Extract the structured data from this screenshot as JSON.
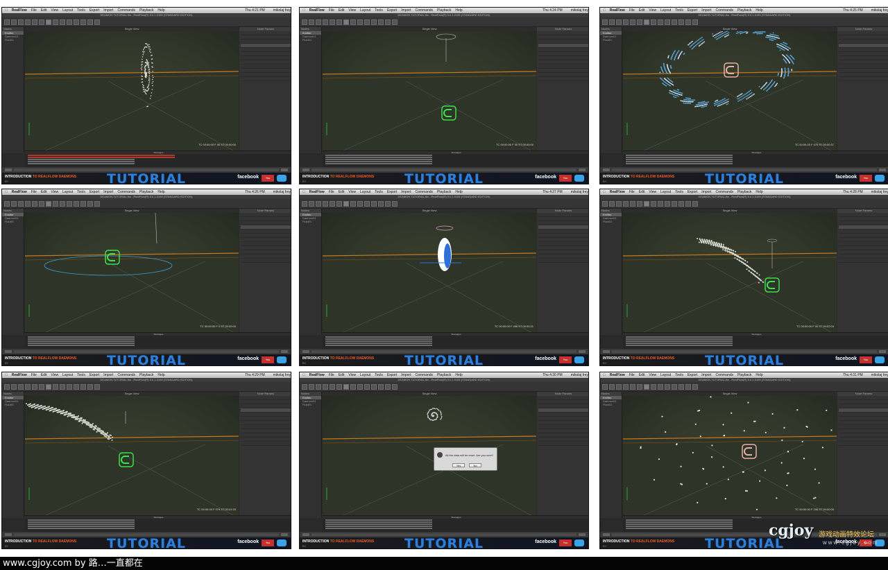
{
  "sheet": {
    "caption": "www.cgjoy.com by 路…一直都在"
  },
  "common": {
    "apple_menu": "",
    "app_name": "RealFlow",
    "menus": [
      "File",
      "Edit",
      "View",
      "Layout",
      "Tools",
      "Export",
      "Import",
      "Commands",
      "Playback",
      "Help"
    ],
    "user": "mikolaj frey",
    "nodes_header": "Nodes",
    "view_header": "Single View",
    "params_header": "Node Params",
    "messages_header": "Messages",
    "banner_intro_bold": "INTRODUCTION",
    "banner_intro_rest": " TO REALFLOW DAEMONS",
    "banner_by": "BY",
    "banner_tutorial": "TUTORIAL",
    "banner_facebook": "facebook",
    "banner_youtube": "You"
  },
  "tiles": [
    {
      "clock": "Thu 4:21 PM",
      "window_title": "DEAMON TUTORIAL.flw - RealFlow(R) 5.0.1.0195 (STANDARD EDITION)",
      "nodes": [
        "Emitter",
        "Daemon01",
        "Fluid01"
      ],
      "timecode": "TC 00:00:00  F 00  ST 00:00:00",
      "scene": "stream"
    },
    {
      "clock": "Thu 4:24 PM",
      "window_title": "DEAMON TUTORIAL.flw - RealFlow(R) 5.0.1.0195 (STANDARD EDITION)",
      "nodes": [
        "Emitter",
        "Daemon01",
        "Fluid01"
      ],
      "timecode": "TC 00:00:00  F 00  ST 00:00:00",
      "scene": "magnet"
    },
    {
      "clock": "Thu 4:25 PM",
      "window_title": "DEAMON TUTORIAL.flw - RealFlow(R) 5.0.1.0195 (STANDARD EDITION)",
      "nodes": [
        "Emitter",
        "Daemon01",
        "Fluid01"
      ],
      "timecode": "TC 00:00:25  F 475  ST 00:00:37",
      "scene": "ring"
    },
    {
      "clock": "Thu 4:26 PM",
      "window_title": "DEAMON TUTORIAL.flw - RealFlow(R) 5.0.1.0195 (STANDARD EDITION)",
      "nodes": [
        "Emitter",
        "Daemon01",
        "Fluid01"
      ],
      "timecode": "TC 00:00:00  F 0  ST 00:00:00",
      "scene": "magnet-ring"
    },
    {
      "clock": "Thu 4:27 PM",
      "window_title": "DEAMON TUTORIAL.flw - RealFlow(R) 5.0.1.0195 (STANDARD EDITION)",
      "nodes": [
        "Emitter",
        "Daemon01",
        "Fluid01"
      ],
      "timecode": "TC 00:00:00  F 496  ST 00:00:21",
      "scene": "capsule"
    },
    {
      "clock": "Thu 4:28 PM",
      "window_title": "DEAMON TUTORIAL.flw - RealFlow(R) 5.0.1.0195 (STANDARD EDITION)",
      "nodes": [
        "Emitter",
        "Daemon01",
        "Fluid01"
      ],
      "timecode": "TC 00:00:00  F 00  ST 00:02:04",
      "scene": "arc"
    },
    {
      "clock": "Thu 4:29 PM",
      "window_title": "DEAMON TUTORIAL.flw - RealFlow(R) 5.0.1.0195 (STANDARD EDITION)",
      "nodes": [
        "Emitter",
        "Daemon01",
        "Fluid01"
      ],
      "timecode": "TC 00:00:39  F 979  ST 00:01:20",
      "scene": "arc2"
    },
    {
      "clock": "Thu 4:30 PM",
      "window_title": "DEAMON TUTORIAL.flw - RealFlow(R) 5.0.1.0195 (STANDARD EDITION)",
      "nodes": [
        "Emitter",
        "Daemon01",
        "Fluid01"
      ],
      "timecode": "",
      "scene": "dialog",
      "dialog_text": "All the data will be reset. Are you sure?",
      "dialog_yes": "Yes",
      "dialog_no": "No"
    },
    {
      "clock": "Thu 4:31 PM",
      "window_title": "DEAMON TUTORIAL.flw - RealFlow(R) 5.0.1.0195 (STANDARD EDITION)",
      "nodes": [
        "Emitter",
        "Daemon01",
        "Fluid01"
      ],
      "timecode": "TC 00:00:00  F 206  ST 00:00:00",
      "scene": "scatter"
    }
  ],
  "watermark": {
    "logo": "cgjoy",
    "chinese": "游戏动画特效论坛",
    "url": "www.cgjoy.com"
  }
}
